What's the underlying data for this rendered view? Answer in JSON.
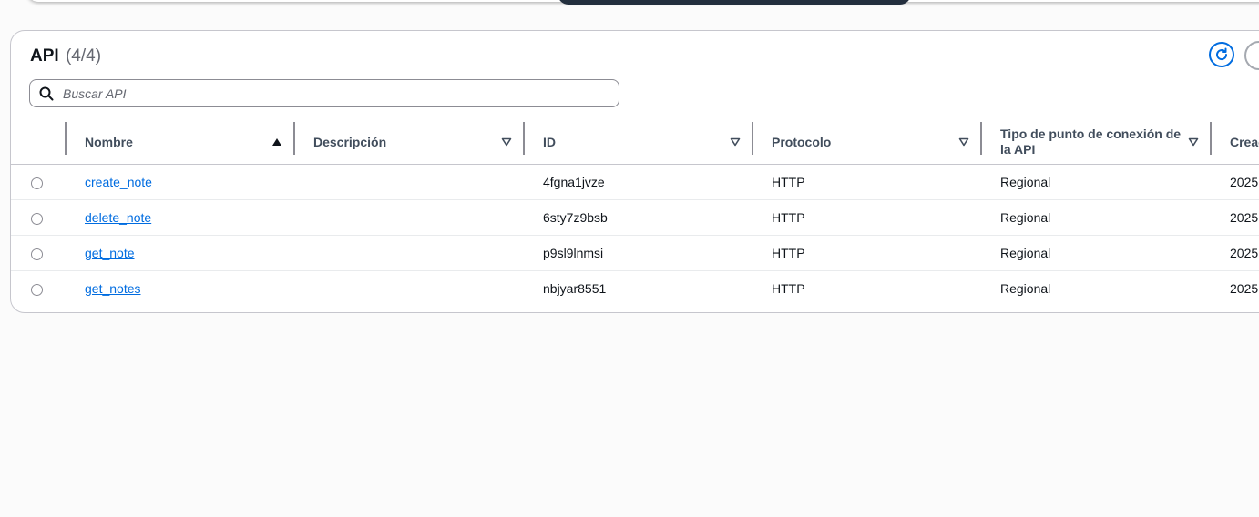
{
  "panel": {
    "title": "API",
    "count": "(4/4)"
  },
  "search": {
    "placeholder": "Buscar API"
  },
  "table": {
    "columns": [
      {
        "label": "Nombre",
        "sort": "ascending"
      },
      {
        "label": "Descripción",
        "sort": "none"
      },
      {
        "label": "ID",
        "sort": "none"
      },
      {
        "label": "Protocolo",
        "sort": "none"
      },
      {
        "label": "Tipo de punto de conexión de la API",
        "sort": "none"
      },
      {
        "label": "Creac",
        "sort": "none"
      }
    ],
    "rows": [
      {
        "name": "create_note",
        "description": "",
        "id": "4fgna1jvze",
        "protocol": "HTTP",
        "endpoint_type": "Regional",
        "created": "2025"
      },
      {
        "name": "delete_note",
        "description": "",
        "id": "6sty7z9bsb",
        "protocol": "HTTP",
        "endpoint_type": "Regional",
        "created": "2025"
      },
      {
        "name": "get_note",
        "description": "",
        "id": "p9sl9lnmsi",
        "protocol": "HTTP",
        "endpoint_type": "Regional",
        "created": "2025"
      },
      {
        "name": "get_notes",
        "description": "",
        "id": "nbjyar8551",
        "protocol": "HTTP",
        "endpoint_type": "Regional",
        "created": "2025"
      }
    ]
  },
  "icons": {
    "search": "search-icon",
    "refresh": "refresh-icon",
    "sort_asc": "sort-ascending-icon",
    "sort_none": "sort-icon"
  },
  "colors": {
    "link": "#006ce0",
    "header_text": "#414d5c",
    "border": "#c6c6cd"
  }
}
